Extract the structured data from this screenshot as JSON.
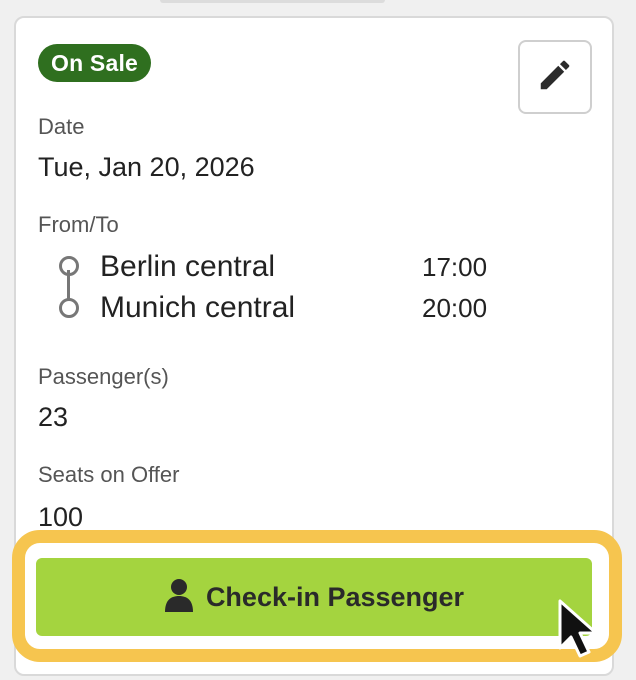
{
  "status_badge": "On Sale",
  "icons": {
    "edit": "pencil-icon",
    "person": "person-icon",
    "cursor": "mouse-pointer-icon"
  },
  "date": {
    "label": "Date",
    "value": "Tue, Jan 20, 2026"
  },
  "route": {
    "label": "From/To",
    "from": {
      "station": "Berlin central",
      "time": "17:00"
    },
    "to": {
      "station": "Munich central",
      "time": "20:00"
    }
  },
  "passengers": {
    "label": "Passenger(s)",
    "value": "23"
  },
  "seats": {
    "label": "Seats on Offer",
    "value": "100"
  },
  "checkin_button": {
    "label": "Check-in Passenger"
  },
  "colors": {
    "badge_bg": "#2f6f1f",
    "button_bg": "#a4d43f",
    "highlight": "#f6c54f"
  }
}
